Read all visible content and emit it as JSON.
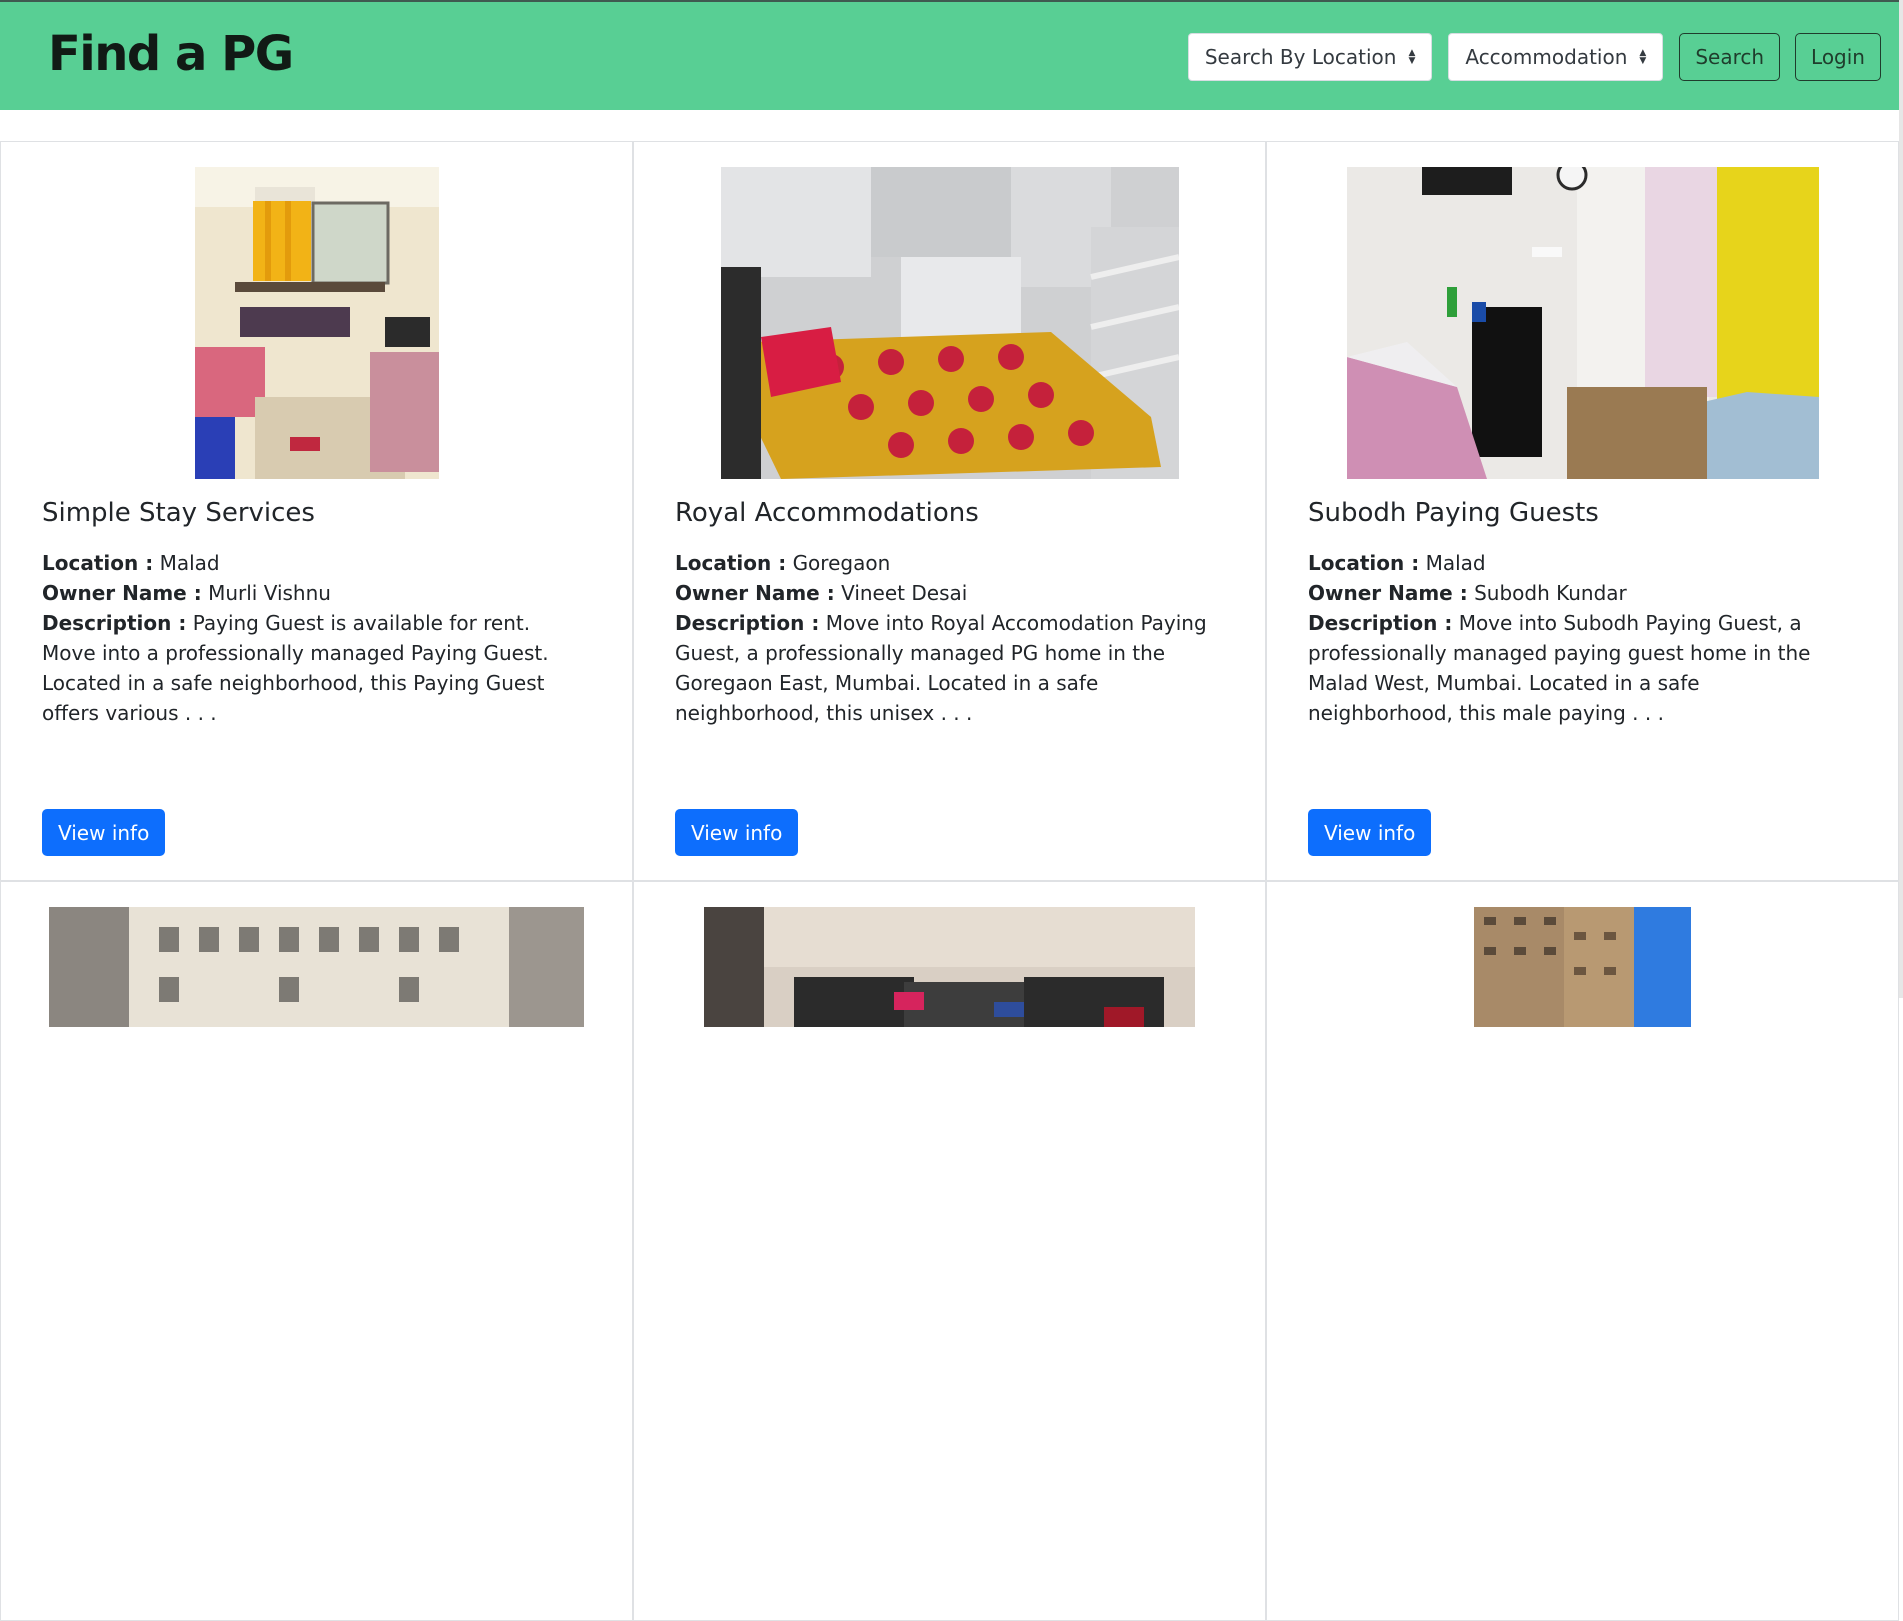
{
  "header": {
    "brand": "Find a PG",
    "location_select": "Search By Location",
    "accommodation_select": "Accommodation",
    "search_button": "Search",
    "login_button": "Login"
  },
  "labels": {
    "location": "Location :",
    "owner": "Owner Name :",
    "description": "Description :"
  },
  "listings": [
    {
      "title": "Simple Stay Services",
      "location": "Malad",
      "owner": "Murli Vishnu",
      "description": "Paying Guest is available for rent. Move into a professionally managed Paying Guest. Located in a safe neighborhood, this Paying Guest offers various . . .",
      "button": "View info"
    },
    {
      "title": "Royal Accommodations",
      "location": "Goregaon",
      "owner": "Vineet Desai",
      "description": "Move into Royal Accomodation Paying Guest, a professionally managed PG home in the Goregaon East, Mumbai. Located in a safe neighborhood, this unisex . . .",
      "button": "View info"
    },
    {
      "title": "Subodh Paying Guests",
      "location": "Malad",
      "owner": "Subodh Kundar",
      "description": "Move into Subodh Paying Guest, a professionally managed paying guest home in the Malad West, Mumbai. Located in a safe neighborhood, this male paying . . .",
      "button": "View info"
    }
  ],
  "colors": {
    "navbar": "#58cf94",
    "primary_button": "#0d6efd",
    "brand_text": "#111a15"
  }
}
